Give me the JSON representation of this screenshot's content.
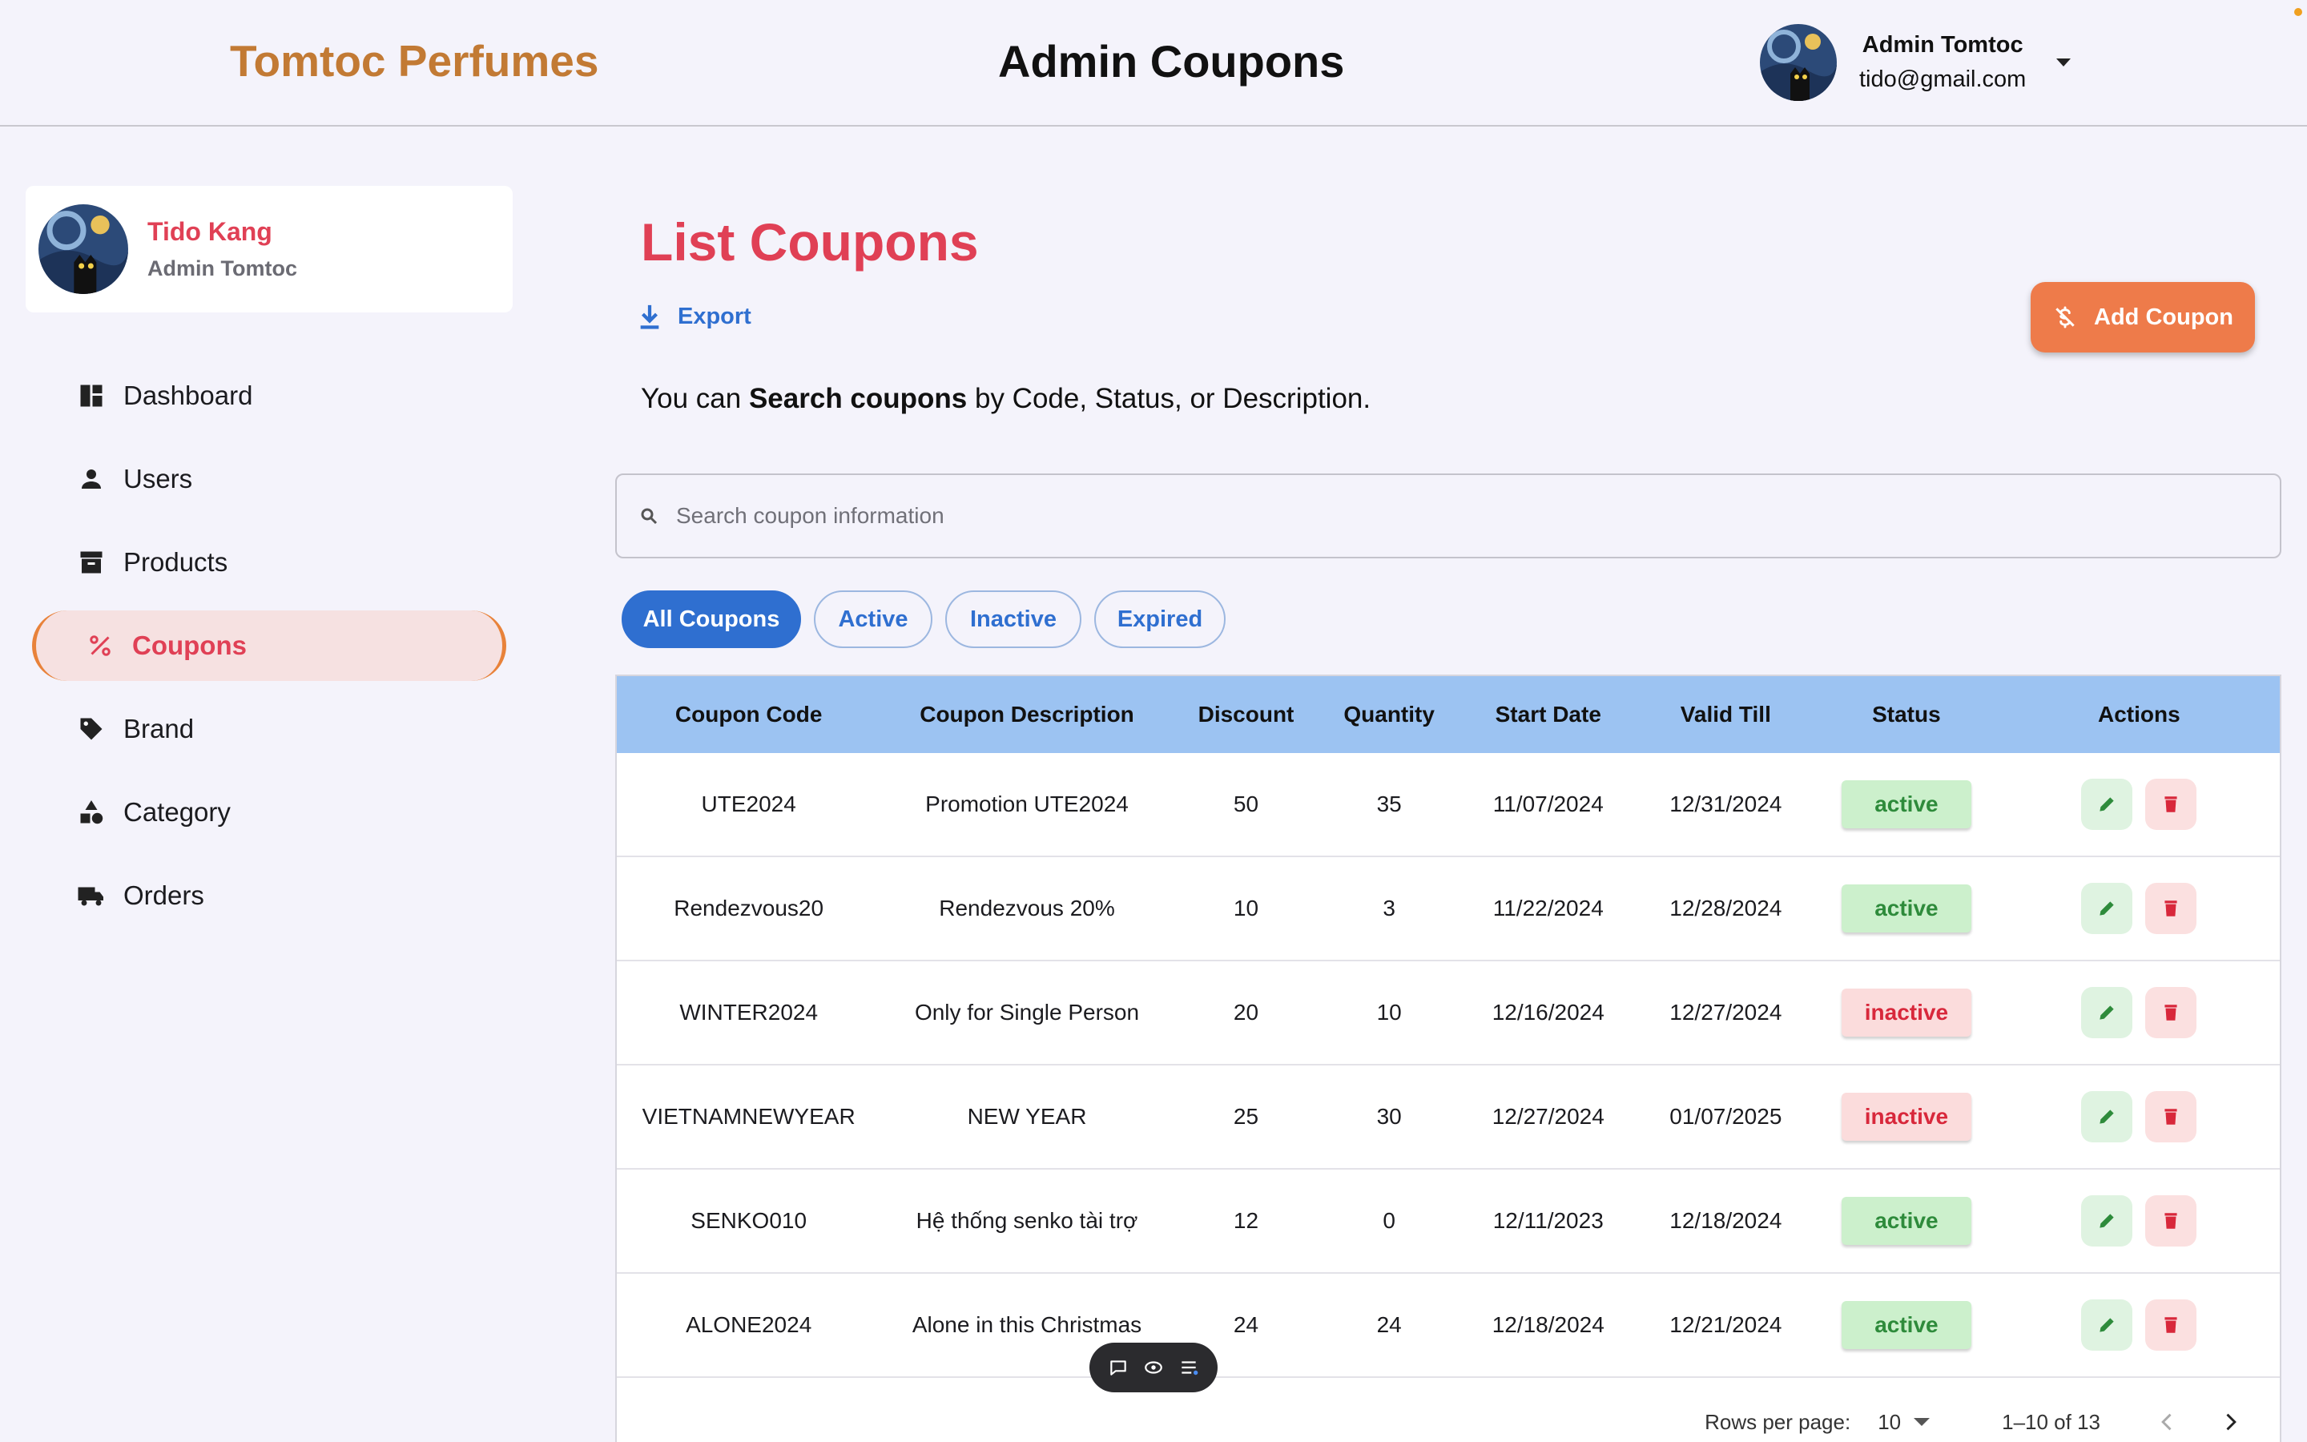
{
  "header": {
    "brand": "Tomtoc Perfumes",
    "page_title": "Admin Coupons",
    "user_name": "Admin Tomtoc",
    "user_email": "tido@gmail.com"
  },
  "profile": {
    "name": "Tido Kang",
    "role": "Admin Tomtoc"
  },
  "sidebar": {
    "items": [
      {
        "label": "Dashboard",
        "icon": "dashboard-icon"
      },
      {
        "label": "Users",
        "icon": "user-icon"
      },
      {
        "label": "Products",
        "icon": "archive-icon"
      },
      {
        "label": "Coupons",
        "icon": "percent-icon"
      },
      {
        "label": "Brand",
        "icon": "tag-icon"
      },
      {
        "label": "Category",
        "icon": "category-icon"
      },
      {
        "label": "Orders",
        "icon": "truck-icon"
      }
    ],
    "active_index": 3
  },
  "main": {
    "title": "List Coupons",
    "export_label": "Export",
    "add_label": "Add Coupon",
    "hint_pre": "You can ",
    "hint_bold": "Search coupons",
    "hint_post": " by Code, Status, or Description.",
    "search_placeholder": "Search coupon information"
  },
  "filters": [
    "All Coupons",
    "Active",
    "Inactive",
    "Expired"
  ],
  "table": {
    "columns": [
      "Coupon Code",
      "Coupon Description",
      "Discount",
      "Quantity",
      "Start Date",
      "Valid Till",
      "Status",
      "Actions"
    ],
    "rows": [
      {
        "code": "UTE2024",
        "description": "Promotion UTE2024",
        "discount": "50",
        "quantity": "35",
        "start": "11/07/2024",
        "valid": "12/31/2024",
        "status": "active"
      },
      {
        "code": "Rendezvous20",
        "description": "Rendezvous 20%",
        "discount": "10",
        "quantity": "3",
        "start": "11/22/2024",
        "valid": "12/28/2024",
        "status": "active"
      },
      {
        "code": "WINTER2024",
        "description": "Only for Single Person",
        "discount": "20",
        "quantity": "10",
        "start": "12/16/2024",
        "valid": "12/27/2024",
        "status": "inactive"
      },
      {
        "code": "VIETNAMNEWYEAR",
        "description": "NEW YEAR",
        "discount": "25",
        "quantity": "30",
        "start": "12/27/2024",
        "valid": "01/07/2025",
        "status": "inactive"
      },
      {
        "code": "SENKO010",
        "description": "Hệ thống senko tài trợ",
        "discount": "12",
        "quantity": "0",
        "start": "12/11/2023",
        "valid": "12/18/2024",
        "status": "active"
      },
      {
        "code": "ALONE2024",
        "description": "Alone in this Christmas",
        "discount": "24",
        "quantity": "24",
        "start": "12/18/2024",
        "valid": "12/21/2024",
        "status": "active"
      }
    ]
  },
  "pagination": {
    "rows_per_page_label": "Rows per page:",
    "rows_per_page": "10",
    "range": "1–10 of 13"
  },
  "colors": {
    "brand": "#c27a34",
    "accent_red": "#e04055",
    "primary_blue": "#2f6fd0",
    "add_button": "#ee7b4a",
    "table_header": "#9cc3f2"
  }
}
